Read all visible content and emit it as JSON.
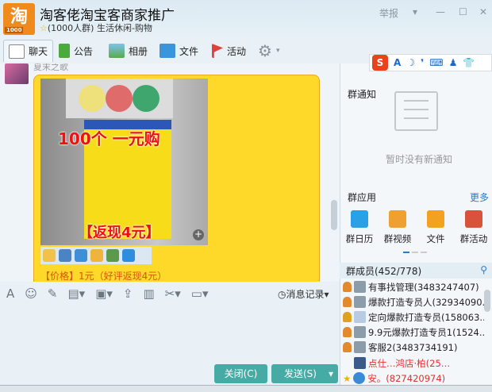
{
  "window": {
    "title": "淘客佬淘宝客商家推广",
    "subtitle": "(1000人群) 生活休闲-购物",
    "logo_text": "淘",
    "logo_badge": "1000",
    "report": "举报",
    "dropdown": "▾",
    "minimize": "—",
    "maximize": "☐",
    "close": "✕"
  },
  "tabs": [
    {
      "label": "聊天"
    },
    {
      "label": "公告"
    },
    {
      "label": "相册"
    },
    {
      "label": "文件"
    },
    {
      "label": "活动"
    }
  ],
  "chat": {
    "sender": "夏末之歌",
    "image_text_1": "100个 一元购",
    "image_text_2": "【返现4元】",
    "price_line": "【价格】1元（好评返现4元）"
  },
  "input": {
    "history_label": "消息记录",
    "close_button": "关闭(C)",
    "send_button": "发送(S)"
  },
  "right": {
    "notice_title": "群通知",
    "no_notice": "暂时没有新通知",
    "apps_title": "群应用",
    "more": "更多",
    "apps": [
      {
        "label": "群日历",
        "color": "#2aa0e6"
      },
      {
        "label": "群视频",
        "color": "#f0a030"
      },
      {
        "label": "文件",
        "color": "#f2a21f"
      },
      {
        "label": "群活动",
        "color": "#d9533c"
      }
    ],
    "members_title": "群成员(452/778)",
    "members": [
      {
        "name": "有事找管理(3483247407)"
      },
      {
        "name": "爆款打造专员人(32934090..."
      },
      {
        "name": "定向爆款打造专员(158063..."
      },
      {
        "name": "9.9元爆款打造专员1(1524..."
      },
      {
        "name": "客服2(3483734191)"
      },
      {
        "name": "点仕…鸿店·柏(25…"
      },
      {
        "name": "安。(827420974)"
      }
    ]
  },
  "ime": {
    "logo": "S",
    "items": [
      "A",
      "☽",
      "❜",
      "⌨",
      "♟",
      "👕"
    ]
  }
}
